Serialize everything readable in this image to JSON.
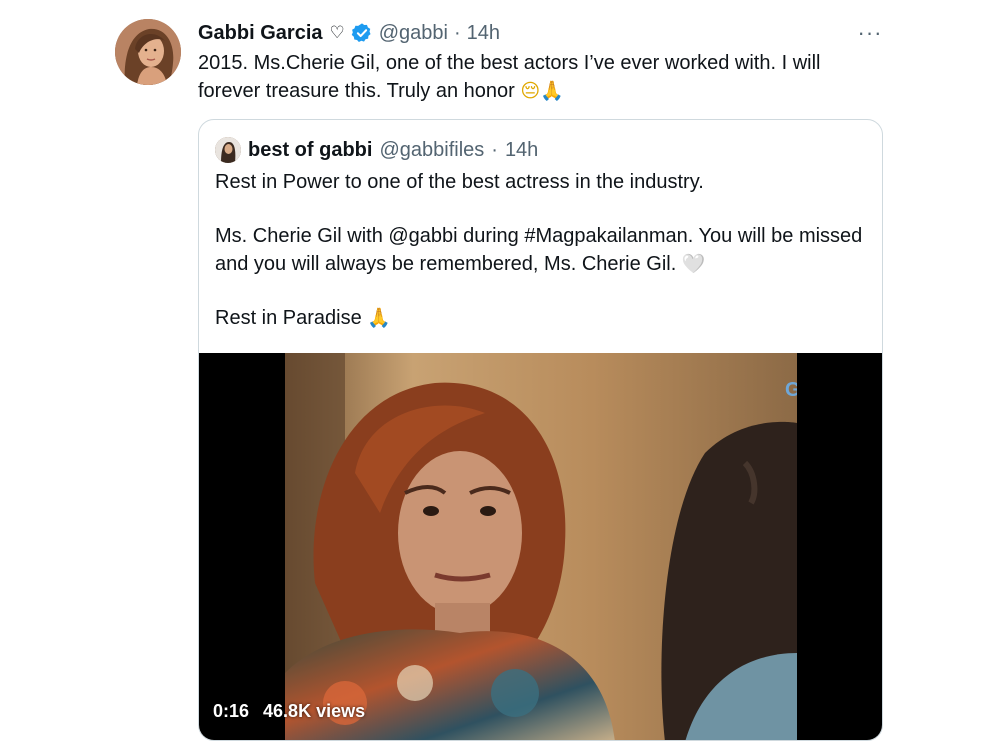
{
  "author": {
    "display_name": "Gabbi Garcia",
    "heart_glyph": "♡",
    "handle": "@gabbi",
    "separator": "·",
    "time": "14h",
    "verified_color": "#1d9bf0"
  },
  "tweet": {
    "text_part1": "2015. Ms.Cherie Gil, one of the best actors I’ve ever worked with. I will forever treasure this. Truly an honor",
    "emoji_1": "😔",
    "emoji_2": "🙏"
  },
  "more_icon": "···",
  "quote": {
    "display_name": "best of gabbi",
    "handle": "@gabbifiles",
    "separator": "·",
    "time": "14h",
    "para1": "Rest in Power to one of the best actress in the industry.",
    "para2": "Ms. Cherie Gil with @gabbi during #Magpakailanman. You will be missed and you will always be remembered, Ms. Cherie Gil.",
    "para2_emoji": "🤍",
    "para3": "Rest in Paradise",
    "para3_emoji": "🙏"
  },
  "video": {
    "watermark": "GMA",
    "duration": "0:16",
    "views": "46.8K views"
  },
  "colors": {
    "text_primary": "#0f1419",
    "text_secondary": "#536471",
    "border": "#cfd9de",
    "accent": "#1d9bf0"
  }
}
